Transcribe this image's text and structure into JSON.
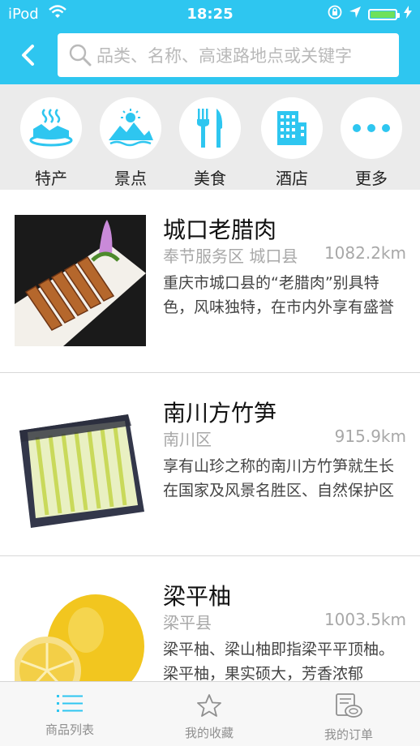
{
  "status_bar": {
    "carrier": "iPod",
    "time": "18:25"
  },
  "search": {
    "placeholder": "品类、名称、高速路地点或关键字"
  },
  "categories": [
    {
      "label": "特产",
      "icon": "specialty-icon"
    },
    {
      "label": "景点",
      "icon": "scenery-icon"
    },
    {
      "label": "美食",
      "icon": "fork-knife-icon"
    },
    {
      "label": "酒店",
      "icon": "hotel-icon"
    },
    {
      "label": "更多",
      "icon": "more-icon"
    }
  ],
  "items": [
    {
      "title": "城口老腊肉",
      "location": "奉节服务区 城口县",
      "distance": "1082.2km",
      "desc": "重庆市城口县的“老腊肉”别具特色，风味独特，在市内外享有盛誉"
    },
    {
      "title": "南川方竹笋",
      "location": "南川区",
      "distance": "915.9km",
      "desc": "享有山珍之称的南川方竹笋就生长在国家及风景名胜区、自然保护区"
    },
    {
      "title": "梁平柚",
      "location": "梁平县",
      "distance": "1003.5km",
      "desc": "梁平柚、梁山柚即指梁平平顶柚。梁平柚，果实硕大，芳香浓郁"
    }
  ],
  "tabs": [
    {
      "label": "商品列表",
      "icon": "list-icon",
      "active": true
    },
    {
      "label": "我的收藏",
      "icon": "star-icon",
      "active": false
    },
    {
      "label": "我的订单",
      "icon": "order-icon",
      "active": false
    }
  ],
  "colors": {
    "accent": "#2ec6f0",
    "category_bg": "#ebebeb",
    "muted": "#a8a8a8"
  }
}
